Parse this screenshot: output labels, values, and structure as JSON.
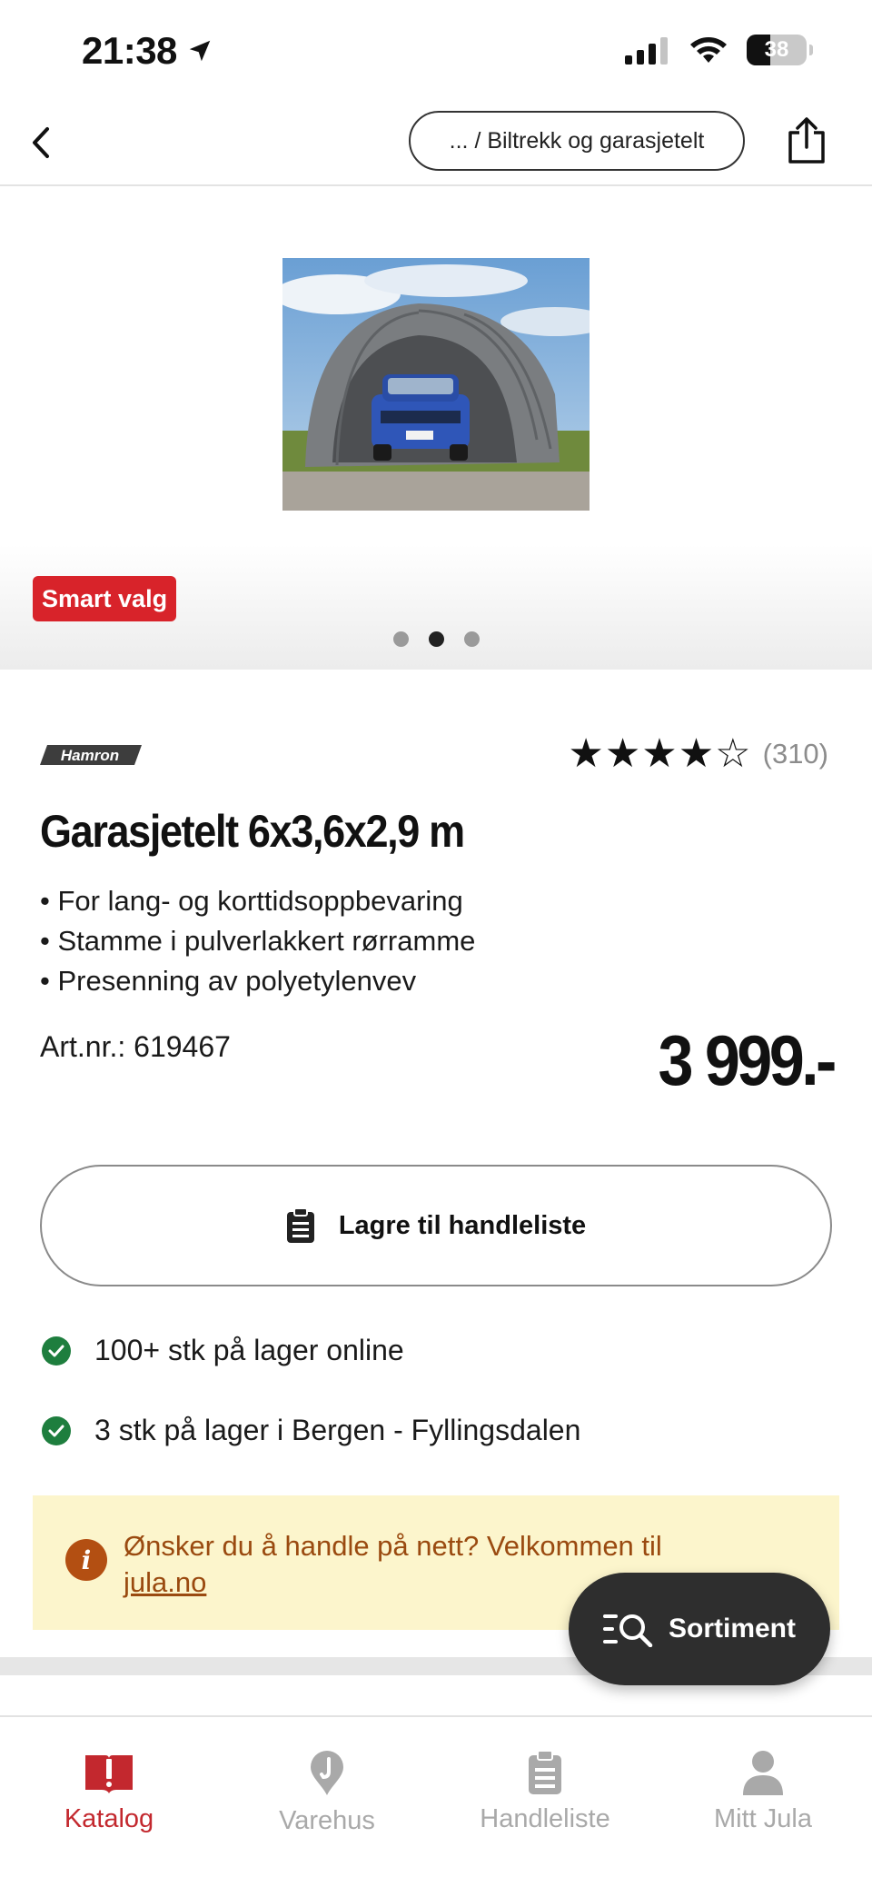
{
  "status_bar": {
    "time": "21:38",
    "battery": "38"
  },
  "header": {
    "breadcrumb": "... / Biltrekk og garasjetelt"
  },
  "gallery": {
    "badge": "Smart valg",
    "dot_count": 3,
    "active_dot": 2
  },
  "product": {
    "brand": "Hamron",
    "rating_stars": "★★★★☆",
    "rating_count": "(310)",
    "title": "Garasjetelt 6x3,6x2,9 m",
    "features": [
      "For lang- og korttidsoppbevaring",
      "Stamme i pulverlakkert rørramme",
      "Presenning av polyetylenvev"
    ],
    "art_nr": "Art.nr.: 619467",
    "price": "3 999.-"
  },
  "actions": {
    "save_label": "Lagre til handleliste"
  },
  "stock": [
    {
      "text": "100+ stk på lager online"
    },
    {
      "text": "3 stk på lager i Bergen - Fyllingsdalen"
    }
  ],
  "info_banner": {
    "text": "Ønsker du å handle på nett? Velkommen til ",
    "link": "jula.no"
  },
  "fab": {
    "label": "Sortiment"
  },
  "tabs": [
    {
      "label": "Katalog",
      "active": true
    },
    {
      "label": "Varehus",
      "active": false
    },
    {
      "label": "Handleliste",
      "active": false
    },
    {
      "label": "Mitt Jula",
      "active": false
    }
  ],
  "colors": {
    "accent_red": "#d8232a",
    "tab_active": "#c3282e",
    "stock_green": "#1e7e3e",
    "info_bg": "#fcf5cc",
    "info_text": "#9a4a10"
  }
}
